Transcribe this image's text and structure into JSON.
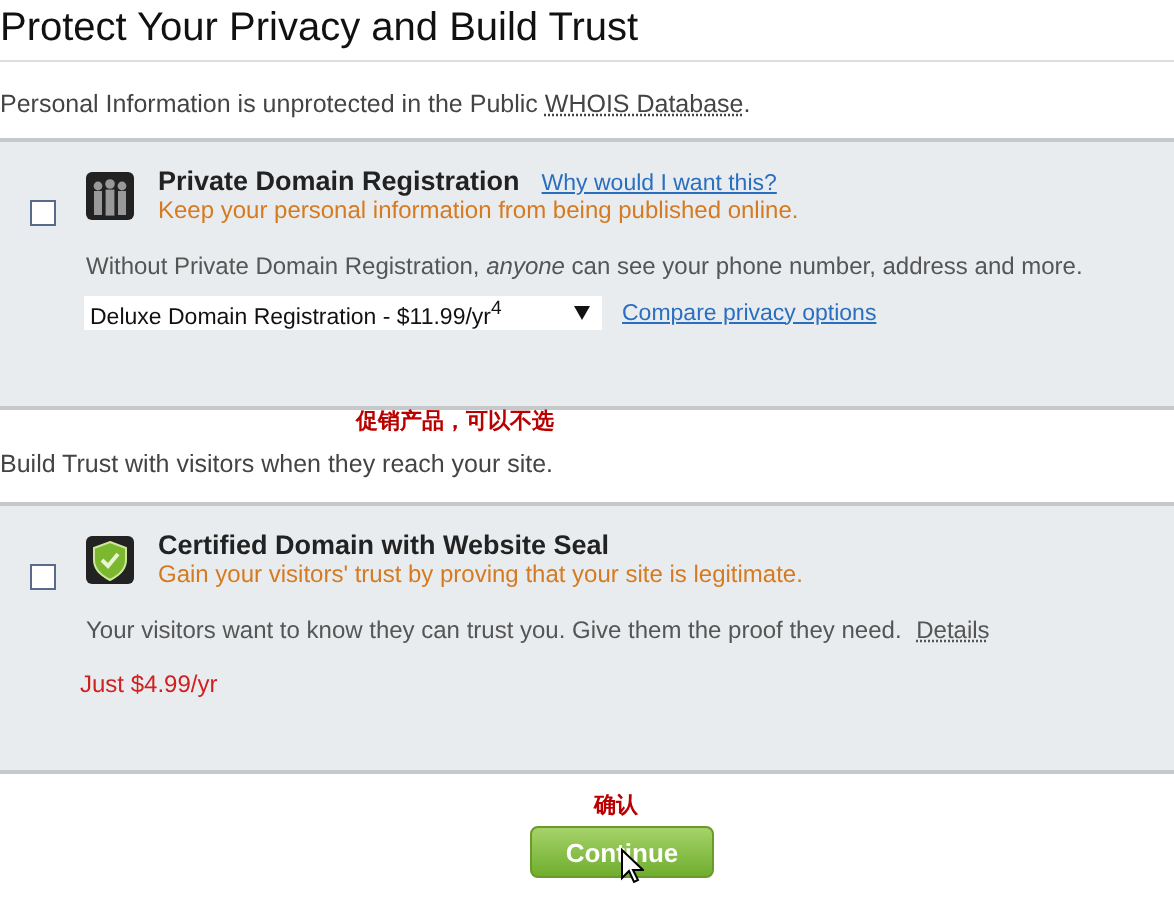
{
  "title": "Protect Your Privacy and Build Trust",
  "privacy_intro": {
    "text": "Personal Information is unprotected in the Public ",
    "link": "WHOIS Database",
    "end": "."
  },
  "offers": [
    {
      "kind": "privacy",
      "checked": false,
      "title": "Private Domain Registration",
      "link": "Why would I want this?",
      "tagline": "Keep your personal information from being published online.",
      "description": "Without Private Domain Registration, *anyone* can see your phone number, address and more.",
      "select_value": "Deluxe Domain Registration - $11.99/yr$^{4}$",
      "extra_link": "Compare privacy options"
    },
    {
      "kind": "seal",
      "checked": false,
      "title": "Certified Domain with Website Seal",
      "tagline": "Gain your visitors' trust by proving that your site is legitimate.",
      "description": "Your visitors want to know they can trust you. Give them the proof they need.",
      "details_link": "Details",
      "price": "Just $4.99/yr"
    }
  ],
  "annotations": [
    "促销产品，可以不选",
    "确认"
  ],
  "trust_intro": "Build Trust with visitors when they reach your site.",
  "continue_button": "Continue"
}
